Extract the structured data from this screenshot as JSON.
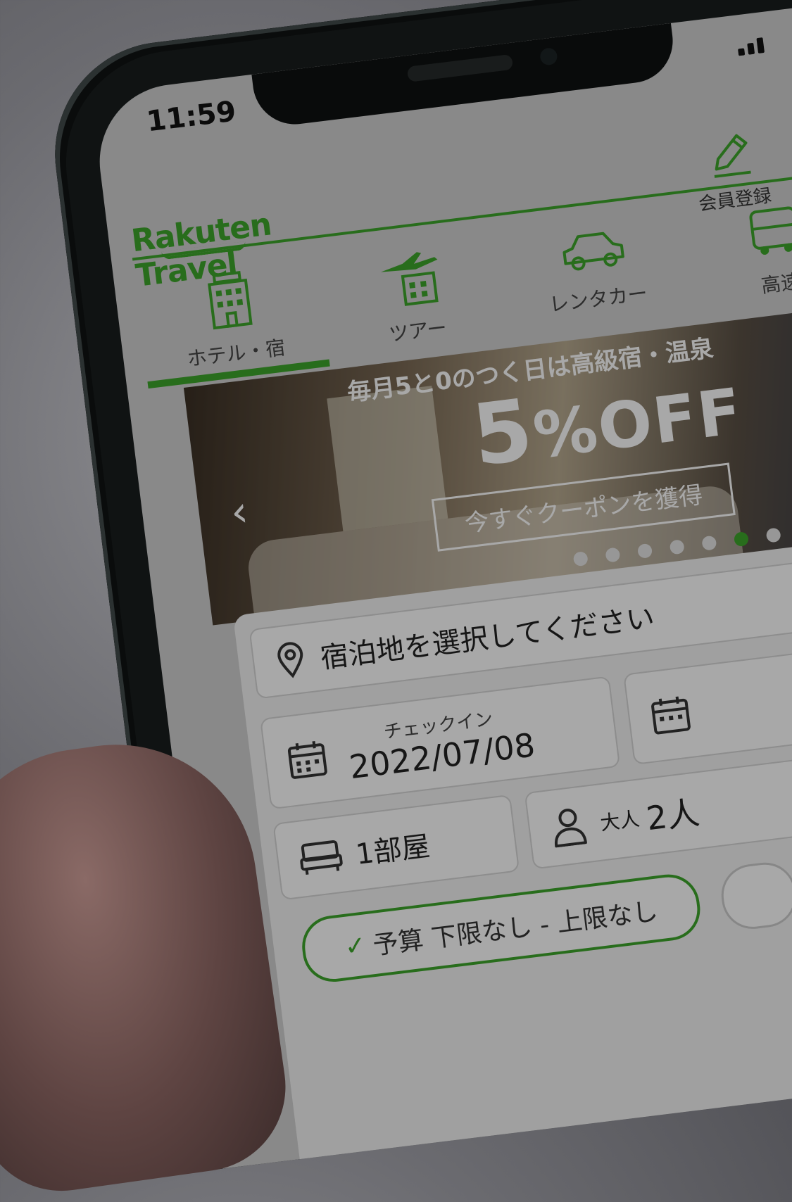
{
  "status_bar": {
    "time": "11:59"
  },
  "header": {
    "logo_line1": "Rakuten",
    "logo_line2": "Travel",
    "member_label": "会員登録"
  },
  "nav": [
    {
      "label": "ホテル・宿",
      "icon": "hotel-icon",
      "active": true
    },
    {
      "label": "ツアー",
      "icon": "tour-icon",
      "active": false
    },
    {
      "label": "レンタカー",
      "icon": "car-icon",
      "active": false
    },
    {
      "label": "高速",
      "icon": "bus-icon",
      "active": false
    }
  ],
  "banner": {
    "headline": "毎月5と0のつく日は高級宿・温泉",
    "discount_number": "5",
    "discount_pct": "%OFF",
    "cta": "今すぐクーポンを獲得",
    "dots_total": 7,
    "dots_active_index": 5
  },
  "search": {
    "destination_placeholder": "宿泊地を選択してください",
    "checkin_caption": "チェックイン",
    "checkin_value": "2022/07/08",
    "rooms": "1部屋",
    "guest_prefix": "大人",
    "guest_count": "2人",
    "budget": "予算 下限なし - 上限なし"
  },
  "colors": {
    "brand_green": "#3da52a",
    "text_dark": "#222222"
  }
}
